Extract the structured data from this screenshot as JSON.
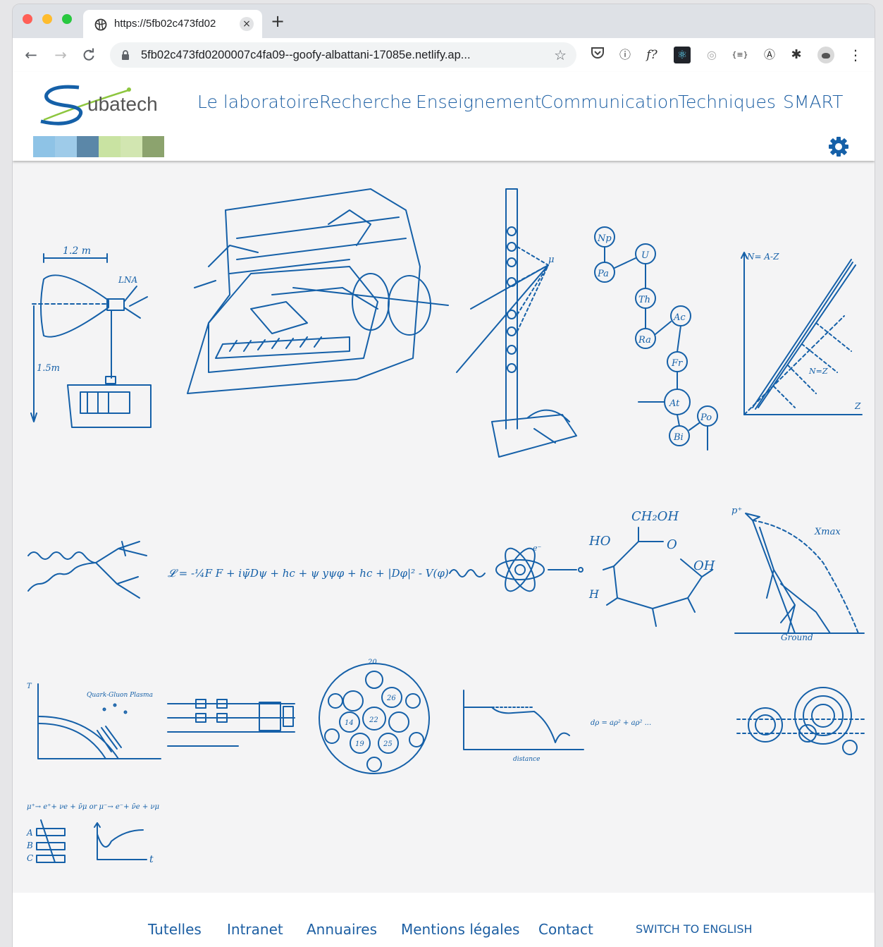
{
  "browser": {
    "tab_title": "https://5fb02c473fd02",
    "close_glyph": "×",
    "new_tab_glyph": "+",
    "url": "5fb02c473fd0200007c4fa09--goofy-albattani-17085e.netlify.ap...",
    "icons": {
      "back": "←",
      "forward": "→",
      "reload": "C",
      "lock": "🔒",
      "star": "☆",
      "pocket": "◡",
      "ext_1password": "ⓘ",
      "ext_fx": "f?",
      "ext_react": "⚛",
      "ext_eye": "◎",
      "ext_json": "{≡}",
      "ext_a": "Ⓐ",
      "ext_puzzle": "✱",
      "menu": "⋮"
    }
  },
  "header": {
    "logo_text": "ubatech",
    "logo_letter": "S",
    "nav": [
      "Le laboratoire",
      "Recherche",
      "Enseignement",
      "Communication",
      "Techniques",
      "SMART"
    ],
    "swatches": [
      "#8ec3e6",
      "#9ecbe9",
      "#5b87a8",
      "#c9e3a2",
      "#d2e6b1",
      "#8ca36e"
    ]
  },
  "gallery": {
    "drawings": [
      {
        "name": "antenna-sketch",
        "labels": [
          "1.2 m",
          "LNA",
          "1.5m"
        ]
      },
      {
        "name": "detector-sketch",
        "labels": []
      },
      {
        "name": "tower-sketch",
        "labels": [
          "μ"
        ]
      },
      {
        "name": "decay-chain-sketch",
        "labels": [
          "Np",
          "Pa",
          "U",
          "Th",
          "Ra",
          "Ac",
          "Fr",
          "At",
          "Bi",
          "Po"
        ]
      },
      {
        "name": "nuclide-chart-sketch",
        "labels": [
          "N= A-Z",
          "Z",
          "N=Z"
        ]
      },
      {
        "name": "feynman-diagram-sketch",
        "labels": []
      },
      {
        "name": "lagrangian-sketch",
        "labels": [
          "𝓛 = -¼F F + iψ̄Dψ + hc + ψ yψφ + hc + |Dφ|² - V(φ)"
        ]
      },
      {
        "name": "atom-sketch",
        "labels": [
          "e⁻"
        ]
      },
      {
        "name": "glucose-sketch",
        "labels": [
          "CH₂OH",
          "HO",
          "OH",
          "H",
          "O"
        ]
      },
      {
        "name": "air-shower-sketch",
        "labels": [
          "p⁺",
          "Xmax",
          "Ground"
        ]
      },
      {
        "name": "phase-diagram-sketch",
        "labels": [
          "T",
          "Quark-Gluon Plasma"
        ]
      },
      {
        "name": "circuit-sketch",
        "labels": []
      },
      {
        "name": "fullerene-sketch",
        "labels": [
          "20",
          "22",
          "26",
          "14",
          "19",
          "25"
        ]
      },
      {
        "name": "signal-plot-sketch",
        "labels": [
          "distance"
        ]
      },
      {
        "name": "equation-sketch",
        "labels": [
          "dρ = aρ² + aρ² ..."
        ]
      },
      {
        "name": "tracks-sketch",
        "labels": []
      },
      {
        "name": "muon-decay-sketch",
        "labels": [
          "μ⁺→ e⁺+ νe + ν̄μ  or  μ⁻→ e⁻+ ν̄e + νμ",
          "A",
          "B",
          "C",
          "t"
        ]
      }
    ]
  },
  "footer": {
    "links": [
      "Tutelles",
      "Intranet",
      "Annuaires",
      "Mentions légales",
      "Contact"
    ],
    "switch_language": "SWITCH TO ENGLISH"
  }
}
